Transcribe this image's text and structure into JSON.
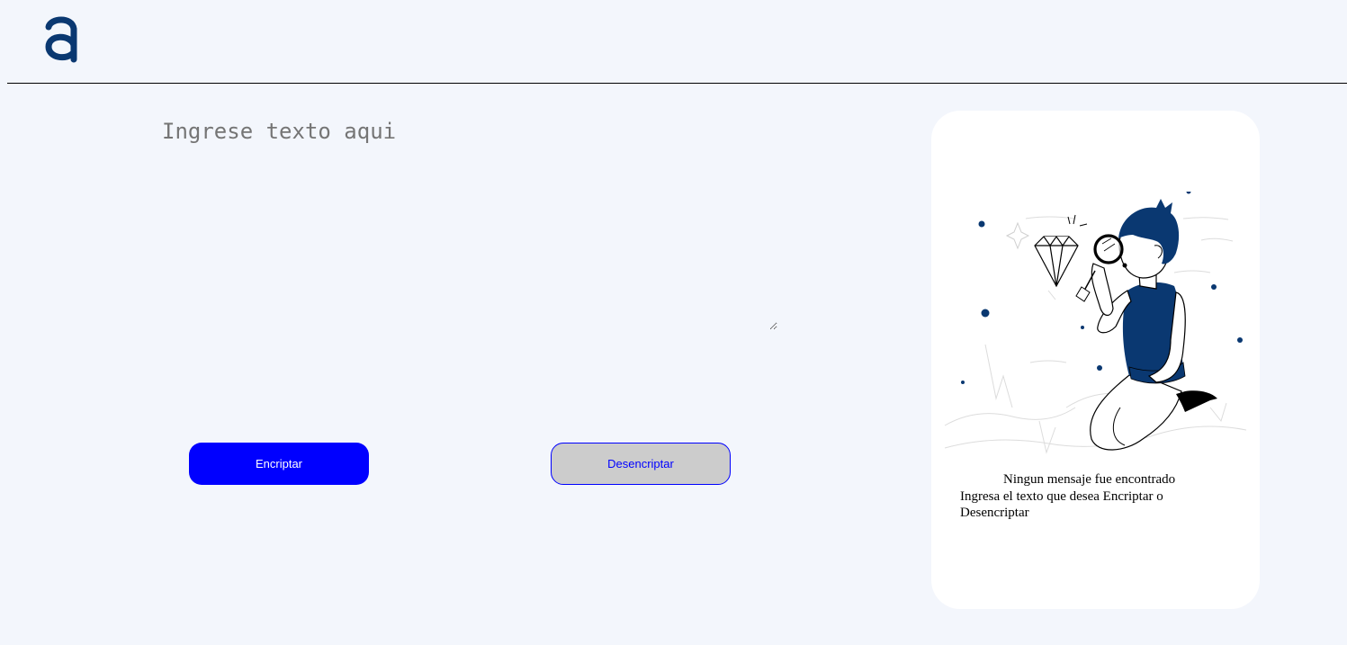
{
  "input": {
    "placeholder": "Ingrese texto aqui"
  },
  "buttons": {
    "encrypt_label": "Encriptar",
    "decrypt_label": "Desencriptar"
  },
  "result": {
    "title": "Ningun mensaje fue encontrado",
    "message": "Ingresa el texto que desea Encriptar o Desencriptar"
  },
  "colors": {
    "background": "#f3f6fc",
    "brand_blue": "#0a3871",
    "button_blue": "#0000ff",
    "button_gray": "#cccccc"
  },
  "icons": {
    "logo": "alura-logo-icon",
    "illustration": "person-with-magnifier-illustration"
  }
}
